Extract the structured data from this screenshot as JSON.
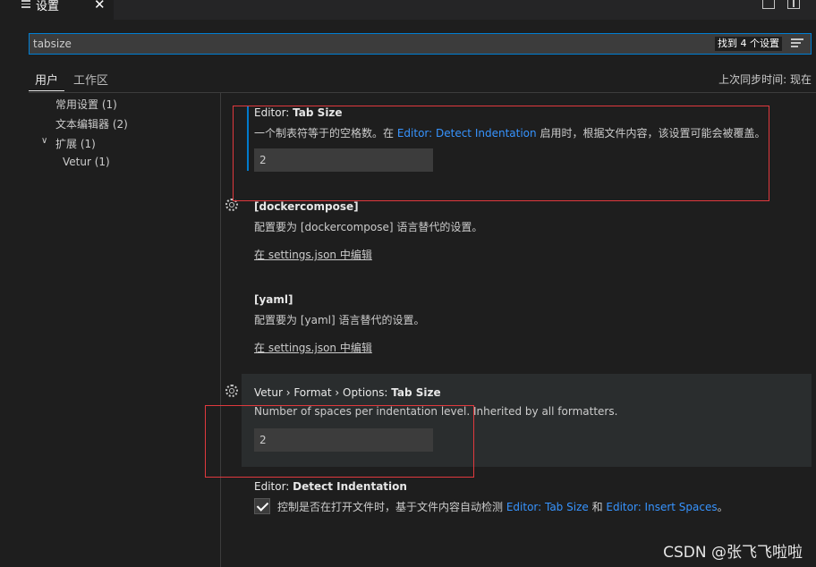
{
  "tab": {
    "label": "设置",
    "close": "✕"
  },
  "search": {
    "value": "tabsize",
    "found": "找到 4 个设置"
  },
  "scope": {
    "user": "用户",
    "workspace": "工作区",
    "sync": "上次同步时间: 现在"
  },
  "toc": {
    "common": "常用设置 (1)",
    "text_editor": "文本编辑器 (2)",
    "extensions_chevron": "∨",
    "extensions": "扩展 (1)",
    "vetur": "Vetur (1)"
  },
  "settings": {
    "tab_size": {
      "category": "Editor: ",
      "name": "Tab Size",
      "desc_before": "一个制表符等于的空格数。在 ",
      "desc_link": "Editor: Detect Indentation",
      "desc_after": " 启用时，根据文件内容，该设置可能会被覆盖。",
      "value": "2"
    },
    "dockercompose": {
      "title": "[dockercompose]",
      "desc": "配置要为 [dockercompose] 语言替代的设置。",
      "edit": "在 settings.json 中编辑"
    },
    "yaml": {
      "title": "[yaml]",
      "desc": "配置要为 [yaml] 语言替代的设置。",
      "edit": "在 settings.json 中编辑"
    },
    "vetur_tab_size": {
      "category": "Vetur › Format › Options: ",
      "name": "Tab Size",
      "desc": "Number of spaces per indentation level. Inherited by all formatters.",
      "value": "2"
    },
    "detect_indentation": {
      "category": "Editor: ",
      "name": "Detect Indentation",
      "desc_before": "控制是否在打开文件时，基于文件内容自动检测 ",
      "link1": "Editor: Tab Size",
      "desc_middle": " 和 ",
      "link2": "Editor: Insert Spaces",
      "desc_after": "。",
      "checked": true
    }
  },
  "watermark": "CSDN @张飞飞啦啦",
  "colors": {
    "background": "#1e1e1e",
    "accent": "#007fd4",
    "link": "#3794ff",
    "annotation": "#e0393e"
  }
}
